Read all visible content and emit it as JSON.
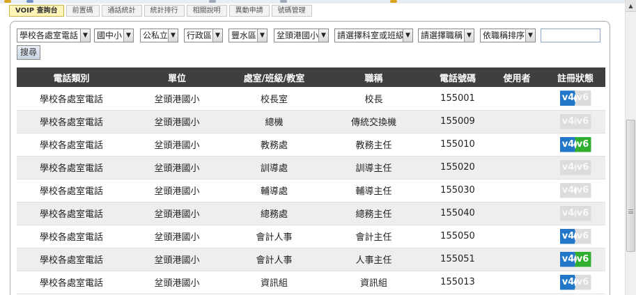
{
  "tabs": [
    {
      "label": "VOIP 查詢台",
      "active": true
    },
    {
      "label": "前置碼",
      "active": false
    },
    {
      "label": "通話統計",
      "active": false
    },
    {
      "label": "統計排行",
      "active": false
    },
    {
      "label": "相關說明",
      "active": false
    },
    {
      "label": "異動申請",
      "active": false
    },
    {
      "label": "號碼管理",
      "active": false
    }
  ],
  "filters": {
    "phone_type": "學校各處室電話",
    "school_level": "國中小",
    "ownership": "公私立",
    "district": "行政區",
    "area": "豐水區",
    "school": "坌頭港國小",
    "office": "請選擇科室或班級",
    "title": "請選擇職稱",
    "sort": "依職稱排序",
    "keyword": "",
    "search_button": "搜尋"
  },
  "table": {
    "columns": [
      "電話類別",
      "單位",
      "處室/班級/教室",
      "職稱",
      "電話號碼",
      "使用者",
      "註冊狀態"
    ],
    "rows": [
      {
        "category": "學校各處室電話",
        "unit": "坌頭港國小",
        "office": "校長室",
        "title": "校長",
        "phone": "155001",
        "user": "",
        "v4": true,
        "v6": false
      },
      {
        "category": "學校各處室電話",
        "unit": "坌頭港國小",
        "office": "總機",
        "title": "傳統交換機",
        "phone": "155009",
        "user": "",
        "v4": false,
        "v6": false
      },
      {
        "category": "學校各處室電話",
        "unit": "坌頭港國小",
        "office": "教務處",
        "title": "教務主任",
        "phone": "155010",
        "user": "",
        "v4": true,
        "v6": true
      },
      {
        "category": "學校各處室電話",
        "unit": "坌頭港國小",
        "office": "訓導處",
        "title": "訓導主任",
        "phone": "155020",
        "user": "",
        "v4": false,
        "v6": false
      },
      {
        "category": "學校各處室電話",
        "unit": "坌頭港國小",
        "office": "輔導處",
        "title": "輔導主任",
        "phone": "155030",
        "user": "",
        "v4": false,
        "v6": false
      },
      {
        "category": "學校各處室電話",
        "unit": "坌頭港國小",
        "office": "總務處",
        "title": "總務主任",
        "phone": "155040",
        "user": "",
        "v4": false,
        "v6": false
      },
      {
        "category": "學校各處室電話",
        "unit": "坌頭港國小",
        "office": "會計人事",
        "title": "會計主任",
        "phone": "155050",
        "user": "",
        "v4": true,
        "v6": false
      },
      {
        "category": "學校各處室電話",
        "unit": "坌頭港國小",
        "office": "會計人事",
        "title": "人事主任",
        "phone": "155051",
        "user": "",
        "v4": true,
        "v6": true
      },
      {
        "category": "學校各處室電話",
        "unit": "坌頭港國小",
        "office": "資訊組",
        "title": "資訊組",
        "phone": "155013",
        "user": "",
        "v4": true,
        "v6": false
      }
    ],
    "badge_v4": "v4",
    "badge_v6": "v6"
  },
  "icons": {
    "dropdown": "chevron-down-icon",
    "scroll_up": "arrow-up-icon",
    "grip": "scroll-grip-icon"
  },
  "colors": {
    "header_bg": "#3f3f3f",
    "alt_row_bg": "#eeeeee",
    "v4_on": "#2277c9",
    "v6_on": "#2fae2f",
    "badge_off": "#dcdcdc",
    "phone_text": "#1f1f9a",
    "active_tab": "#fff5b8"
  }
}
